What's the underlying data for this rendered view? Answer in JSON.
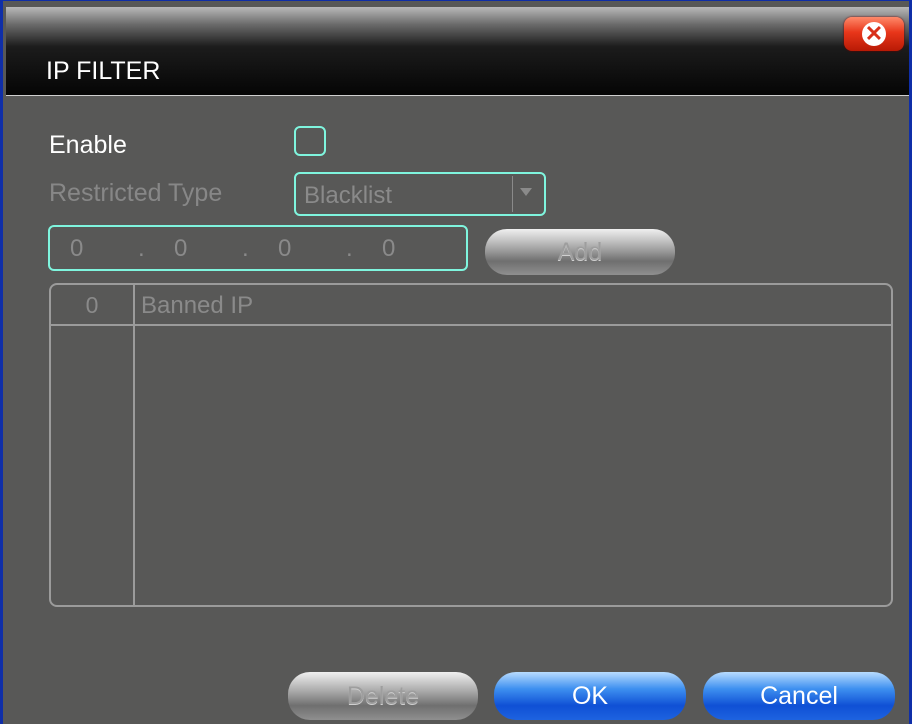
{
  "dialog": {
    "title": "IP FILTER",
    "close_icon": "close-icon"
  },
  "enable": {
    "label": "Enable",
    "checked": false
  },
  "restricted_type": {
    "label": "Restricted Type",
    "value": "Blacklist"
  },
  "ip_input": {
    "octets": [
      "0",
      "0",
      "0",
      "0"
    ],
    "separator": "."
  },
  "buttons": {
    "add": "Add",
    "delete": "Delete",
    "ok": "OK",
    "cancel": "Cancel"
  },
  "table": {
    "count": "0",
    "header": "Banned IP",
    "rows": []
  },
  "colors": {
    "accent_border": "#7ff5de",
    "background": "#585857",
    "primary_button": "#1d63e0"
  }
}
